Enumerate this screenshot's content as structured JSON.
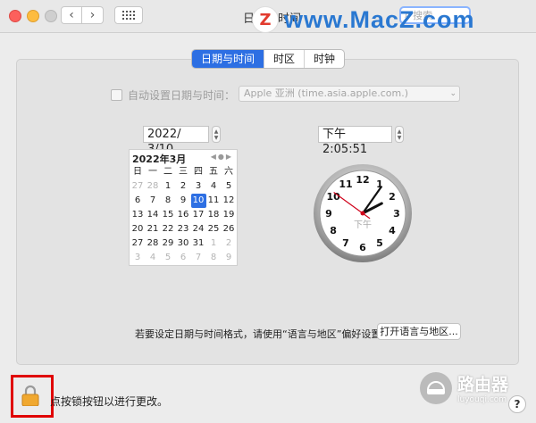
{
  "window": {
    "title": "日期与时间",
    "search_placeholder": "搜索"
  },
  "watermark": {
    "logo": "Z",
    "text": "www.MacZ.com"
  },
  "tabs": [
    {
      "label": "日期与时间"
    },
    {
      "label": "时区"
    },
    {
      "label": "时钟"
    }
  ],
  "autoset": {
    "label": "自动设置日期与时间：",
    "server": "Apple 亚洲 (time.asia.apple.com.)"
  },
  "date_field": {
    "value": "2022/  3/10"
  },
  "time_field": {
    "value": "下午  2:05:51"
  },
  "calendar": {
    "month_label": "2022年3月",
    "weekdays": [
      "日",
      "一",
      "二",
      "三",
      "四",
      "五",
      "六"
    ],
    "days": [
      {
        "d": "27",
        "dim": true
      },
      {
        "d": "28",
        "dim": true
      },
      {
        "d": "1"
      },
      {
        "d": "2"
      },
      {
        "d": "3"
      },
      {
        "d": "4"
      },
      {
        "d": "5"
      },
      {
        "d": "6"
      },
      {
        "d": "7"
      },
      {
        "d": "8"
      },
      {
        "d": "9"
      },
      {
        "d": "10",
        "selected": true
      },
      {
        "d": "11"
      },
      {
        "d": "12"
      },
      {
        "d": "13"
      },
      {
        "d": "14"
      },
      {
        "d": "15"
      },
      {
        "d": "16"
      },
      {
        "d": "17"
      },
      {
        "d": "18"
      },
      {
        "d": "19"
      },
      {
        "d": "20"
      },
      {
        "d": "21"
      },
      {
        "d": "22"
      },
      {
        "d": "23"
      },
      {
        "d": "24"
      },
      {
        "d": "25"
      },
      {
        "d": "26"
      },
      {
        "d": "27"
      },
      {
        "d": "28"
      },
      {
        "d": "29"
      },
      {
        "d": "30"
      },
      {
        "d": "31"
      },
      {
        "d": "1",
        "dim": true
      },
      {
        "d": "2",
        "dim": true
      },
      {
        "d": "3",
        "dim": true
      },
      {
        "d": "4",
        "dim": true
      },
      {
        "d": "5",
        "dim": true
      },
      {
        "d": "6",
        "dim": true
      },
      {
        "d": "7",
        "dim": true
      },
      {
        "d": "8",
        "dim": true
      },
      {
        "d": "9",
        "dim": true
      }
    ]
  },
  "clock": {
    "numbers": [
      "12",
      "1",
      "2",
      "3",
      "4",
      "5",
      "6",
      "7",
      "8",
      "9",
      "10",
      "11"
    ],
    "ampm": "下午",
    "hour": 2,
    "minute": 5,
    "second": 51
  },
  "footer": {
    "hint": "若要设定日期与时间格式，请使用“语言与地区”偏好设置。",
    "lang_button": "打开语言与地区..."
  },
  "lock": {
    "text": "点按锁按钮以进行更改。"
  },
  "help": {
    "label": "?"
  },
  "brand": {
    "cn": "路由器",
    "en": "luyouqi.com"
  },
  "colors": {
    "accent": "#2d6fe3",
    "lock_highlight": "#e00000",
    "second_hand": "#d0021b"
  }
}
